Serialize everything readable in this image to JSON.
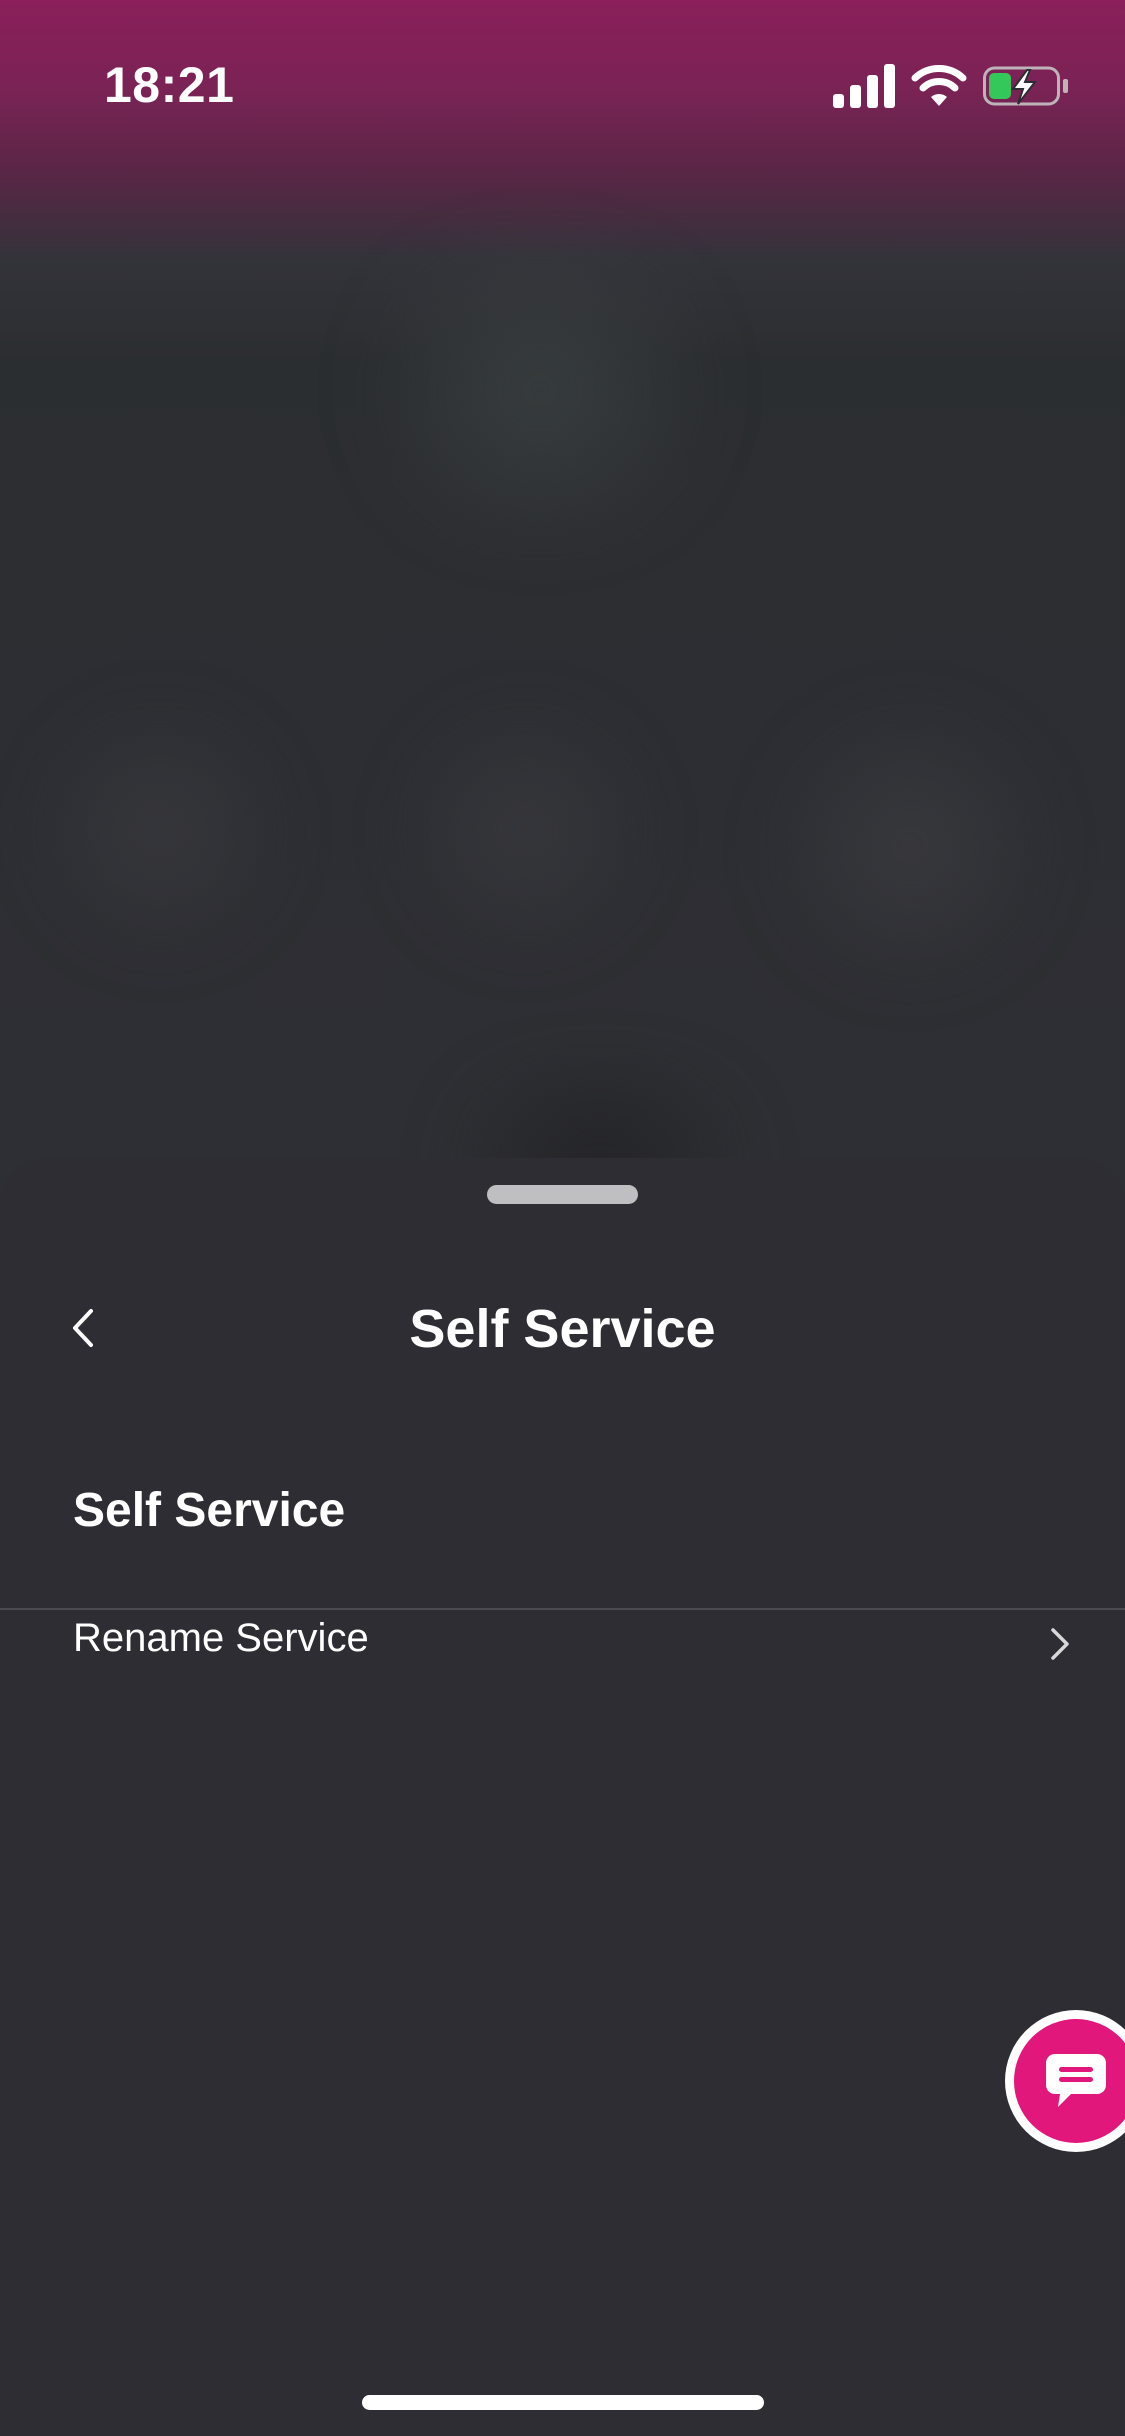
{
  "status_bar": {
    "time": "18:21",
    "icons": [
      "signal-icon",
      "wifi-icon",
      "battery-charging-icon"
    ],
    "battery_color": "#34c759"
  },
  "sheet": {
    "nav": {
      "back_icon": "chevron-left-icon",
      "title": "Self Service"
    },
    "section": {
      "heading": "Self Service",
      "items": [
        {
          "label": "Rename Service",
          "icon": "chevron-right-icon"
        }
      ]
    }
  },
  "chat_button": {
    "icon": "chat-bubble-icon",
    "color": "#e1177c"
  },
  "colors": {
    "brand_magenta": "#8a1f5b",
    "sheet_background": "#2e2d33"
  }
}
